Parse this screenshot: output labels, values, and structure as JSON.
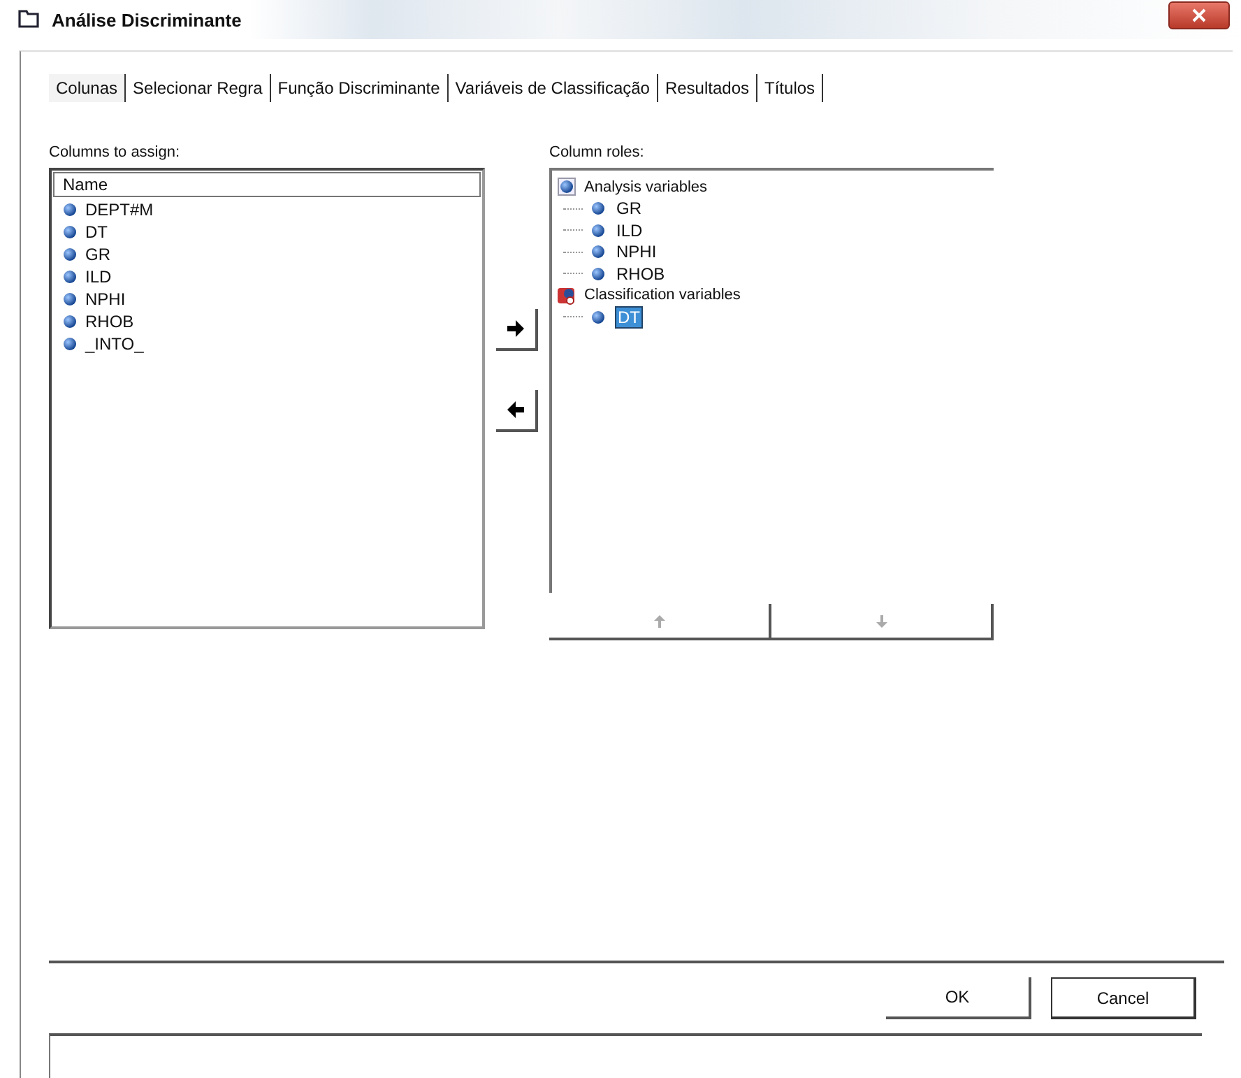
{
  "window": {
    "title": "Análise Discriminante"
  },
  "tabs": [
    {
      "label": "Colunas",
      "selected": true
    },
    {
      "label": "Selecionar Regra",
      "selected": false
    },
    {
      "label": "Função Discriminante",
      "selected": false
    },
    {
      "label": "Variáveis de Classificação",
      "selected": false
    },
    {
      "label": "Resultados",
      "selected": false
    },
    {
      "label": "Títulos",
      "selected": false
    }
  ],
  "columns_to_assign": {
    "label": "Columns to assign:",
    "header": "Name",
    "items": [
      {
        "label": "DEPT#M",
        "selected": false
      },
      {
        "label": "DT",
        "selected": false
      },
      {
        "label": "GR",
        "selected": false
      },
      {
        "label": "ILD",
        "selected": false
      },
      {
        "label": "NPHI",
        "selected": false
      },
      {
        "label": "RHOB",
        "selected": false
      },
      {
        "label": "_INTO_",
        "selected": false
      }
    ]
  },
  "transfer_buttons": [
    {
      "kind": "right"
    },
    {
      "kind": "left"
    }
  ],
  "column_roles": {
    "label": "Column roles:",
    "tree": [
      {
        "label": "Analysis variables",
        "kind": "analysis",
        "children": [
          {
            "label": "GR",
            "selected": false
          },
          {
            "label": "ILD",
            "selected": false
          },
          {
            "label": "NPHI",
            "selected": false
          },
          {
            "label": "RHOB",
            "selected": false
          }
        ]
      },
      {
        "label": "Classification variables",
        "kind": "classification",
        "children": [
          {
            "label": "DT",
            "selected": true
          }
        ]
      }
    ],
    "move_buttons": [
      {
        "kind": "up",
        "disabled": true
      },
      {
        "kind": "down",
        "disabled": true
      }
    ]
  },
  "buttons": [
    {
      "label": "OK",
      "kind": "flat"
    },
    {
      "label": "Cancel",
      "kind": "bordered"
    }
  ]
}
